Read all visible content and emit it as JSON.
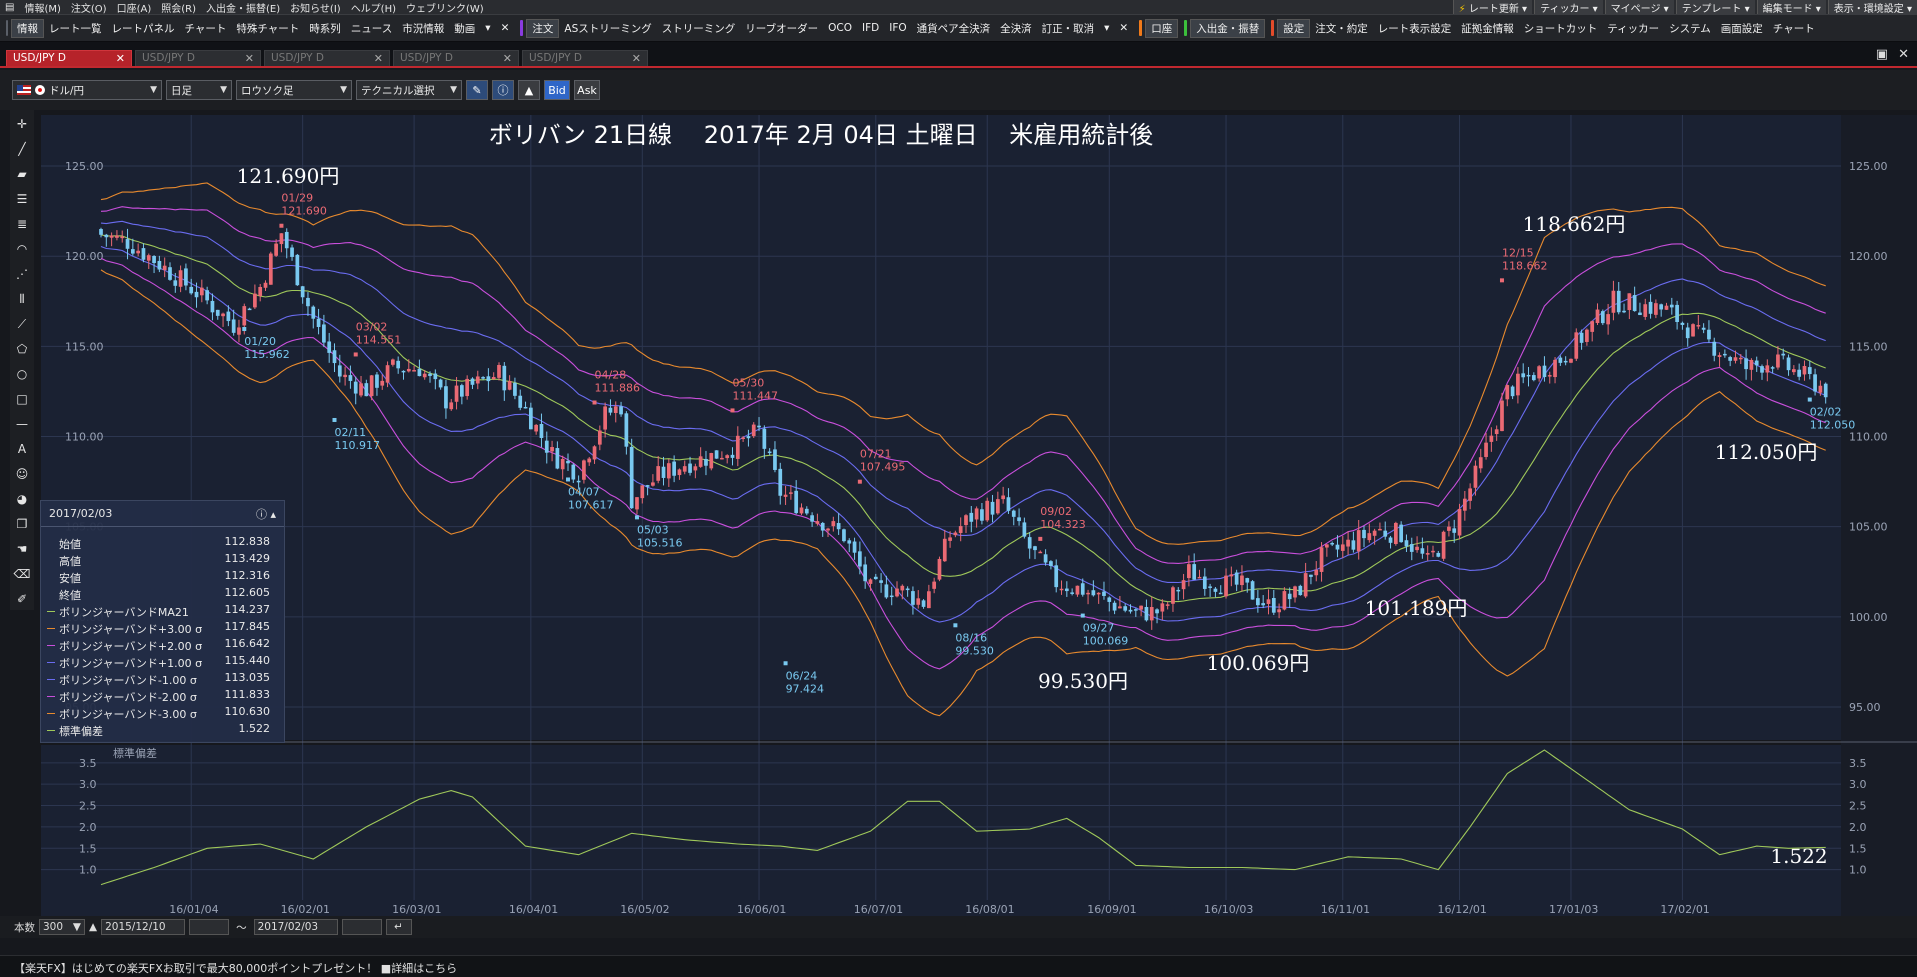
{
  "menubar": {
    "items": [
      "情報(M)",
      "注文(O)",
      "口座(A)",
      "照会(R)",
      "入出金・振替(E)",
      "お知らせ(I)",
      "ヘルプ(H)",
      "ウェブリンク(W)"
    ],
    "right": [
      "レート更新",
      "ティッカー",
      "マイページ",
      "テンプレート",
      "編集モード",
      "表示・環境設定"
    ]
  },
  "toolbar": {
    "info": "情報",
    "items1": [
      "レート一覧",
      "レートパネル",
      "チャート",
      "特殊チャート",
      "時系列",
      "ニュース",
      "市況情報",
      "動画"
    ],
    "order": "注文",
    "items2": [
      "ASストリーミング",
      "ストリーミング",
      "リーブオーダー",
      "OCO",
      "IFD",
      "IFO",
      "通貨ペア全決済",
      "全決済",
      "訂正・取消"
    ],
    "account": "口座",
    "deposit": "入出金・振替",
    "settings": "設定",
    "items3": [
      "注文・約定",
      "レート表示設定",
      "証拠金情報",
      "ショートカット",
      "ティッカー",
      "システム",
      "画面設定",
      "チャート"
    ]
  },
  "tabs": [
    "USD/JPY D",
    "USD/JPY D",
    "USD/JPY D",
    "USD/JPY D",
    "USD/JPY D"
  ],
  "controls": {
    "pair": "ドル/円",
    "period": "日足",
    "chart_type": "ロウソク足",
    "technical": "テクニカル選択",
    "bid": "Bid",
    "ask": "Ask"
  },
  "title_annotation": "ボリバン 21日線　 2017年 2月 04日 土曜日　 米雇用統計後",
  "annotations": [
    {
      "text": "121.690円"
    },
    {
      "text": "118.662円"
    },
    {
      "text": "112.050円"
    },
    {
      "text": "101.189円"
    },
    {
      "text": "99.530円"
    },
    {
      "text": "100.069円"
    },
    {
      "text": "1.522"
    }
  ],
  "markers": [
    {
      "date": "01/29",
      "value": "121.690",
      "kind": "high"
    },
    {
      "date": "01/20",
      "value": "115.962",
      "kind": "low"
    },
    {
      "date": "03/02",
      "value": "114.551",
      "kind": "high"
    },
    {
      "date": "02/11",
      "value": "110.917",
      "kind": "low"
    },
    {
      "date": "04/28",
      "value": "111.886",
      "kind": "high"
    },
    {
      "date": "04/07",
      "value": "107.617",
      "kind": "low"
    },
    {
      "date": "05/30",
      "value": "111.447",
      "kind": "high"
    },
    {
      "date": "05/03",
      "value": "105.516",
      "kind": "low"
    },
    {
      "date": "07/21",
      "value": "107.495",
      "kind": "high"
    },
    {
      "date": "06/24",
      "value": "97.424",
      "kind": "low"
    },
    {
      "date": "09/02",
      "value": "104.323",
      "kind": "high"
    },
    {
      "date": "08/16",
      "value": "99.530",
      "kind": "low"
    },
    {
      "date": "12/15",
      "value": "118.662",
      "kind": "high"
    },
    {
      "date": "09/27",
      "value": "100.069",
      "kind": "low"
    },
    {
      "date": "02/02",
      "value": "112.050",
      "kind": "low"
    }
  ],
  "info": {
    "date": "2017/02/03",
    "rows": [
      {
        "label": "始値",
        "value": "112.838",
        "color": ""
      },
      {
        "label": "高値",
        "value": "113.429",
        "color": ""
      },
      {
        "label": "安値",
        "value": "112.316",
        "color": ""
      },
      {
        "label": "終値",
        "value": "112.605",
        "color": ""
      },
      {
        "label": "ボリンジャーバンドMA21",
        "value": "114.237",
        "color": "#9fc85a"
      },
      {
        "label": "ボリンジャーバンド+3.00 σ",
        "value": "117.845",
        "color": "#e88a2e"
      },
      {
        "label": "ボリンジャーバンド+2.00 σ",
        "value": "116.642",
        "color": "#c94fdc"
      },
      {
        "label": "ボリンジャーバンド+1.00 σ",
        "value": "115.440",
        "color": "#6a6cf0"
      },
      {
        "label": "ボリンジャーバンド-1.00 σ",
        "value": "113.035",
        "color": "#6a6cf0"
      },
      {
        "label": "ボリンジャーバンド-2.00 σ",
        "value": "111.833",
        "color": "#c94fdc"
      },
      {
        "label": "ボリンジャーバンド-3.00 σ",
        "value": "110.630",
        "color": "#e88a2e"
      },
      {
        "label": "標準偏差",
        "value": "1.522",
        "color": "#9fc85a"
      }
    ]
  },
  "subchart_label": "標準偏差",
  "bottom": {
    "count_label": "本数",
    "count": "300",
    "from": "2015/12/10",
    "sep": "～",
    "to": "2017/02/03"
  },
  "status": "【楽天FX】はじめての楽天FXお取引で最大80,000ポイントプレゼント！ ■詳細はこちら",
  "colors": {
    "up": "#ea6a74",
    "down": "#79c9f0",
    "mid": "#9fc85a",
    "s1": "#6a6cf0",
    "s2": "#c94fdc",
    "s3": "#e88a2e",
    "bg": "#1a2132",
    "high_label": "#ea6a74",
    "low_label": "#79c9f0"
  },
  "chart_data": {
    "type": "candlestick",
    "title": "ボリバン 21日線　 2017年 2月 04日 土曜日　 米雇用統計後",
    "symbol": "USD/JPY",
    "period": "日足",
    "y_ticks": [
      95,
      100,
      105,
      110,
      115,
      120,
      125
    ],
    "ylim": [
      94,
      127
    ],
    "sub_y_ticks": [
      1.0,
      1.5,
      2.0,
      2.5,
      3.0,
      3.5
    ],
    "sub_ylim": [
      0.5,
      3.8
    ],
    "x_ticks": [
      "16/01/04",
      "16/02/01",
      "16/03/01",
      "16/04/01",
      "16/05/02",
      "16/06/01",
      "16/07/01",
      "16/08/01",
      "16/09/01",
      "16/10/03",
      "16/11/01",
      "16/12/01",
      "17/01/03",
      "17/02/01"
    ],
    "close_path": [
      [
        0,
        121.2
      ],
      [
        5,
        120.8
      ],
      [
        10,
        119.8
      ],
      [
        18,
        118.0
      ],
      [
        25,
        116.2
      ],
      [
        30,
        118.3
      ],
      [
        34,
        121.3
      ],
      [
        40,
        116.5
      ],
      [
        45,
        113.4
      ],
      [
        50,
        112.6
      ],
      [
        55,
        113.8
      ],
      [
        60,
        113.8
      ],
      [
        65,
        112.0
      ],
      [
        70,
        112.8
      ],
      [
        75,
        113.5
      ],
      [
        80,
        111.5
      ],
      [
        85,
        109.0
      ],
      [
        90,
        108.0
      ],
      [
        95,
        111.2
      ],
      [
        98,
        111.7
      ],
      [
        100,
        106.5
      ],
      [
        105,
        107.8
      ],
      [
        110,
        108.5
      ],
      [
        115,
        108.9
      ],
      [
        120,
        109.5
      ],
      [
        124,
        110.3
      ],
      [
        128,
        106.9
      ],
      [
        135,
        105.5
      ],
      [
        140,
        104.5
      ],
      [
        145,
        101.5
      ],
      [
        150,
        101.6
      ],
      [
        155,
        100.8
      ],
      [
        160,
        104.5
      ],
      [
        165,
        105.8
      ],
      [
        170,
        106.3
      ],
      [
        175,
        103.8
      ],
      [
        180,
        101.9
      ],
      [
        185,
        101.5
      ],
      [
        190,
        100.8
      ],
      [
        195,
        100.2
      ],
      [
        200,
        100.3
      ],
      [
        205,
        102.5
      ],
      [
        210,
        101.9
      ],
      [
        215,
        101.7
      ],
      [
        220,
        100.6
      ],
      [
        225,
        101.2
      ],
      [
        230,
        103.3
      ],
      [
        235,
        104.0
      ],
      [
        240,
        104.8
      ],
      [
        245,
        104.6
      ],
      [
        250,
        103.0
      ],
      [
        255,
        105.1
      ],
      [
        260,
        108.5
      ],
      [
        265,
        112.5
      ],
      [
        270,
        113.5
      ],
      [
        275,
        114.3
      ],
      [
        280,
        115.8
      ],
      [
        285,
        117.5
      ],
      [
        290,
        117.3
      ],
      [
        295,
        117.0
      ],
      [
        300,
        115.8
      ],
      [
        305,
        114.8
      ],
      [
        310,
        113.8
      ],
      [
        315,
        114.2
      ],
      [
        320,
        113.5
      ],
      [
        325,
        112.6
      ]
    ],
    "stddev_path": [
      [
        0,
        0.65
      ],
      [
        10,
        1.05
      ],
      [
        20,
        1.5
      ],
      [
        30,
        1.6
      ],
      [
        40,
        1.25
      ],
      [
        50,
        2.0
      ],
      [
        60,
        2.65
      ],
      [
        66,
        2.85
      ],
      [
        70,
        2.7
      ],
      [
        80,
        1.55
      ],
      [
        90,
        1.35
      ],
      [
        100,
        1.85
      ],
      [
        110,
        1.7
      ],
      [
        120,
        1.6
      ],
      [
        128,
        1.55
      ],
      [
        135,
        1.45
      ],
      [
        145,
        1.9
      ],
      [
        152,
        2.6
      ],
      [
        158,
        2.6
      ],
      [
        165,
        1.9
      ],
      [
        175,
        1.95
      ],
      [
        182,
        2.2
      ],
      [
        188,
        1.75
      ],
      [
        195,
        1.1
      ],
      [
        205,
        1.05
      ],
      [
        215,
        1.05
      ],
      [
        225,
        1.0
      ],
      [
        235,
        1.3
      ],
      [
        245,
        1.25
      ],
      [
        252,
        1.0
      ],
      [
        258,
        2.0
      ],
      [
        265,
        3.25
      ],
      [
        272,
        3.8
      ],
      [
        280,
        3.1
      ],
      [
        288,
        2.4
      ],
      [
        298,
        1.95
      ],
      [
        305,
        1.35
      ],
      [
        312,
        1.55
      ],
      [
        318,
        1.5
      ],
      [
        325,
        1.52
      ]
    ],
    "band_mult": 1,
    "values_final": {
      "close": 112.605,
      "ma21": 114.237,
      "stddev": 1.522
    }
  }
}
